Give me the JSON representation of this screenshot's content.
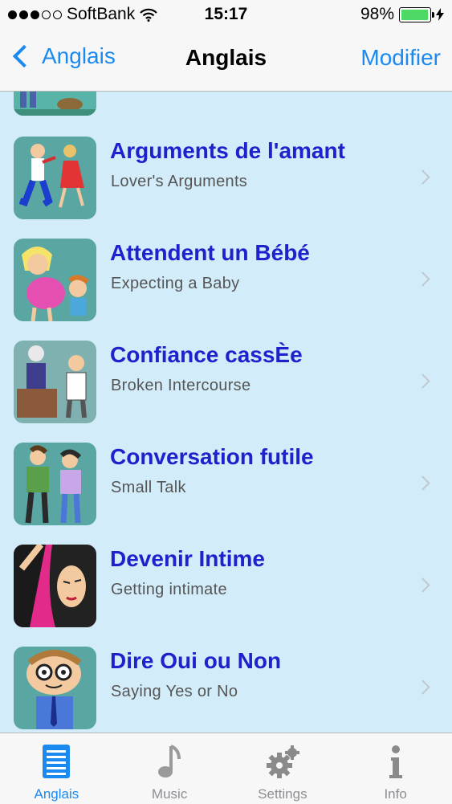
{
  "status": {
    "carrier": "SoftBank",
    "time": "15:17",
    "battery": "98%",
    "battery_level": 0.98
  },
  "nav": {
    "back_label": "Anglais",
    "title": "Anglais",
    "edit_label": "Modifier"
  },
  "list": [
    {
      "title": "Arguments de l'amant",
      "subtitle": "Lover's Arguments"
    },
    {
      "title": "Attendent un Bébé",
      "subtitle": "Expecting a Baby"
    },
    {
      "title": "Confiance cassÈe",
      "subtitle": "Broken Intercourse"
    },
    {
      "title": "Conversation futile",
      "subtitle": "Small Talk"
    },
    {
      "title": "Devenir Intime",
      "subtitle": "Getting intimate"
    },
    {
      "title": "Dire Oui ou Non",
      "subtitle": "Saying Yes or No"
    }
  ],
  "tabs": [
    {
      "label": "Anglais",
      "icon": "list-icon",
      "active": true
    },
    {
      "label": "Music",
      "icon": "music-note-icon",
      "active": false
    },
    {
      "label": "Settings",
      "icon": "gear-icon",
      "active": false
    },
    {
      "label": "Info",
      "icon": "info-icon",
      "active": false
    }
  ],
  "colors": {
    "accent": "#1a8af0",
    "title": "#1f22cc",
    "list_bg": "#d3ecfa"
  }
}
